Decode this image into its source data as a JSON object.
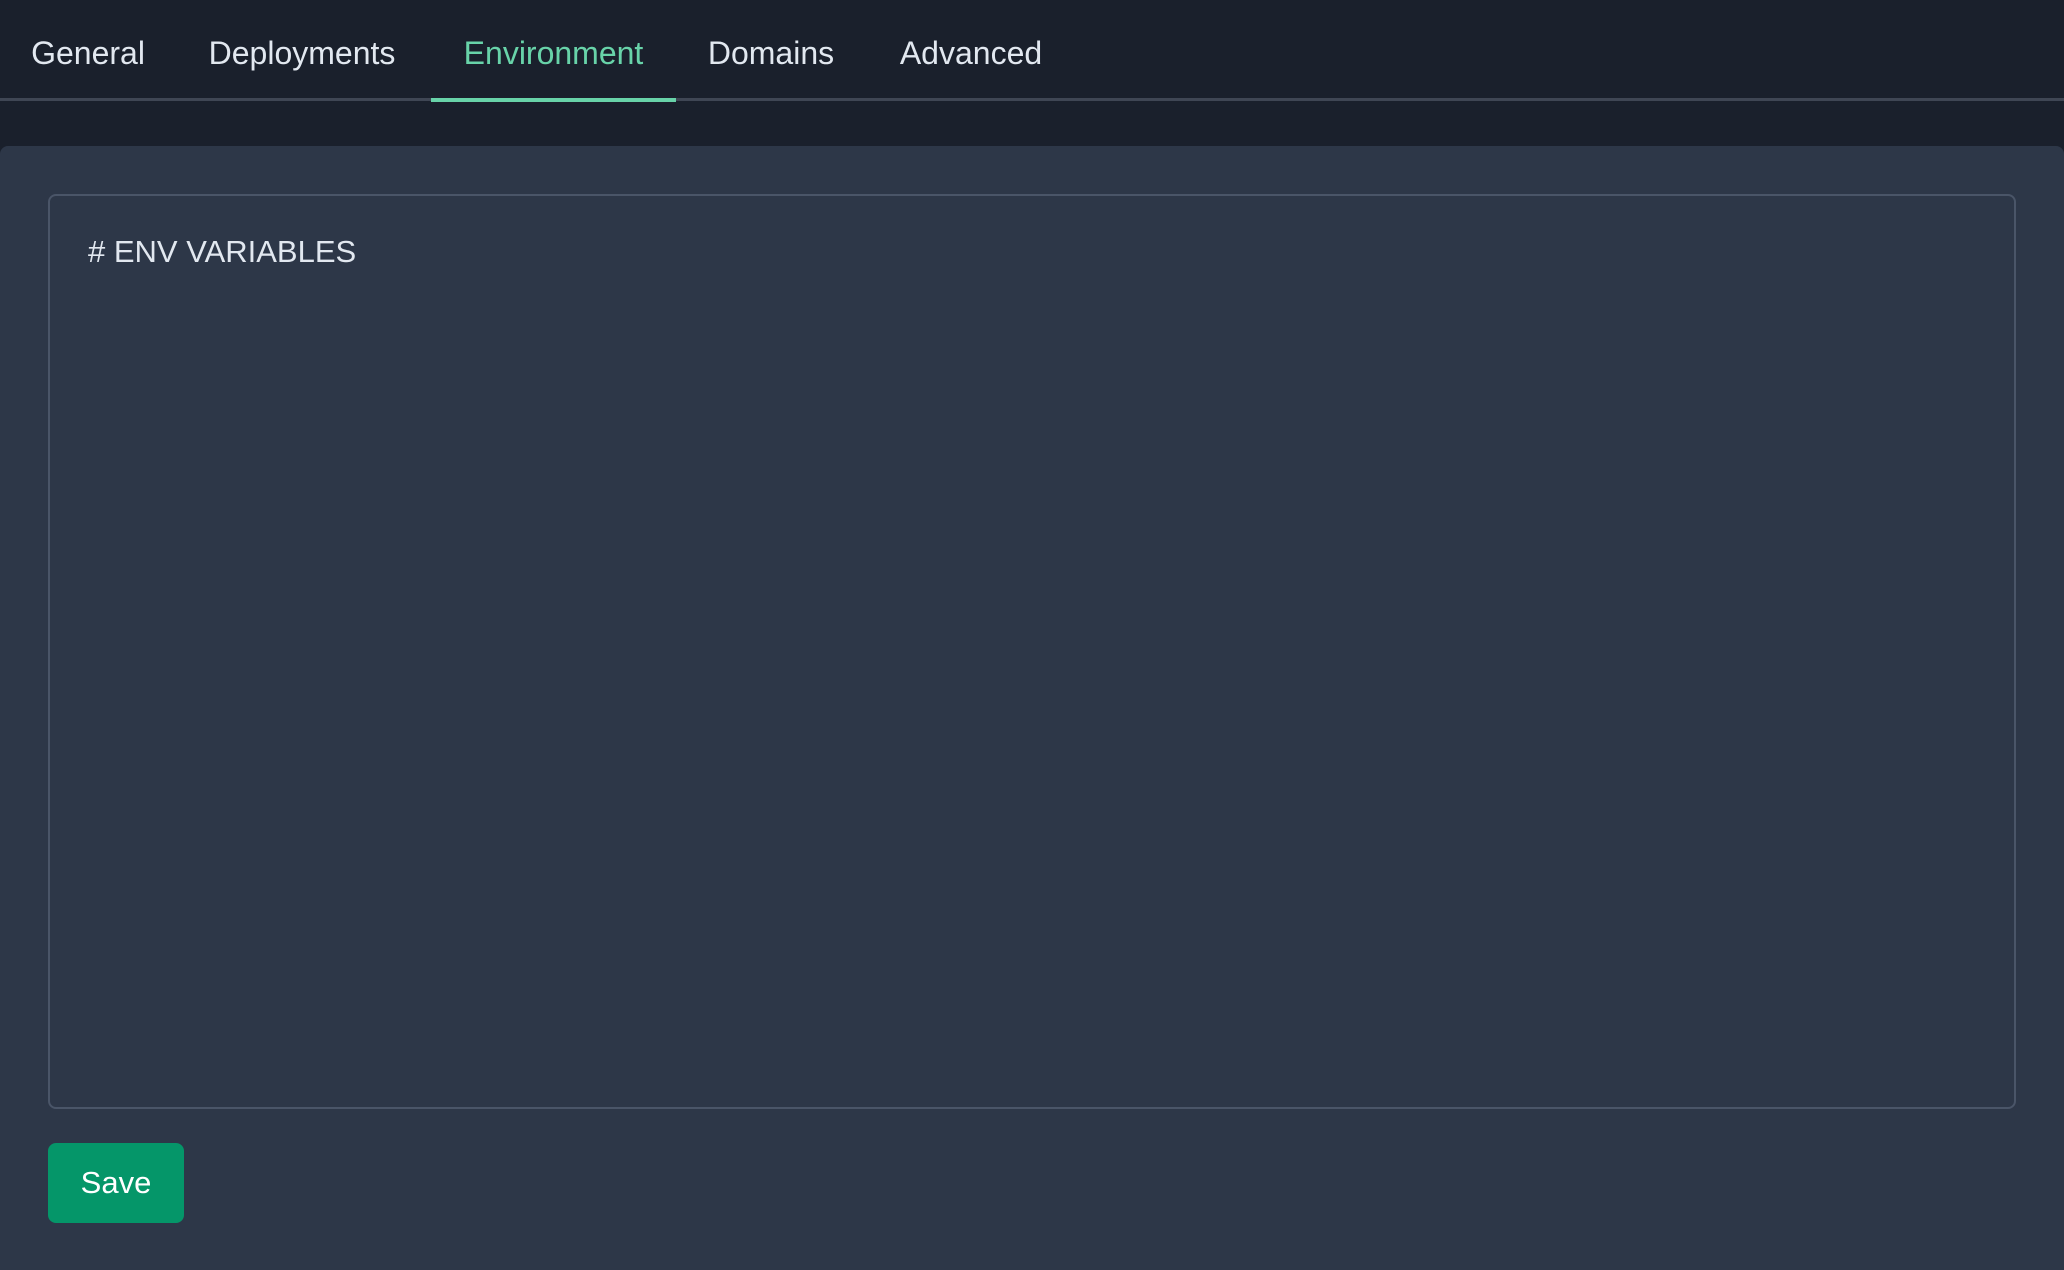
{
  "tabs": {
    "items": [
      {
        "label": "General"
      },
      {
        "label": "Deployments"
      },
      {
        "label": "Environment"
      },
      {
        "label": "Domains"
      },
      {
        "label": "Advanced"
      }
    ],
    "active": "Environment"
  },
  "editor": {
    "content": "# ENV VARIABLES"
  },
  "actions": {
    "save_label": "Save"
  },
  "colors": {
    "background": "#1a202c",
    "panel": "#2d3748",
    "accent": "#68d3a9",
    "button": "#059669"
  }
}
